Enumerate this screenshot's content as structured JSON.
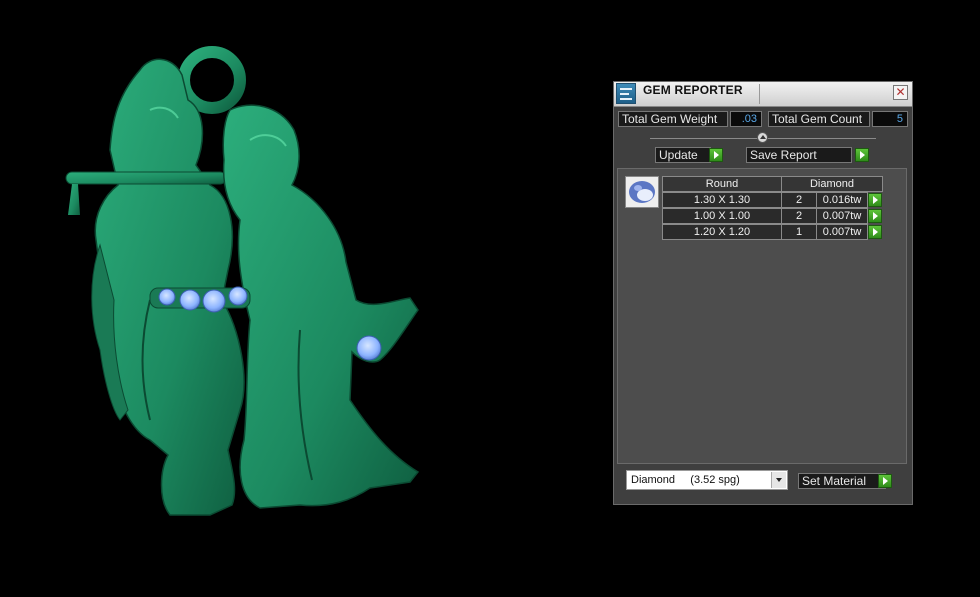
{
  "panel": {
    "title": "GEM REPORTER",
    "close_symbol": "✕",
    "total_weight_label": "Total Gem Weight",
    "total_weight_value": ".03",
    "total_count_label": "Total Gem Count",
    "total_count_value": "5",
    "update_label": "Update",
    "save_report_label": "Save Report",
    "table": {
      "headers": [
        "Round",
        "Diamond"
      ],
      "rows": [
        {
          "size": "1.30 X 1.30",
          "count": "2",
          "weight": "0.016tw"
        },
        {
          "size": "1.00 X 1.00",
          "count": "2",
          "weight": "0.007tw"
        },
        {
          "size": "1.20 X 1.20",
          "count": "1",
          "weight": "0.007tw"
        }
      ]
    },
    "material_select": "Diamond     (3.52 spg)",
    "set_material_label": "Set Material"
  },
  "icons": {
    "app": "gem-reporter-app-icon",
    "close": "close-icon",
    "gem_shape": "round-gem-icon",
    "go": "green-arrow-icon",
    "dropdown": "chevron-down-icon"
  },
  "colors": {
    "model_green": "#1f8a62",
    "gem_blue": "#8fb6ff",
    "go_green": "#3fa82a",
    "value_blue": "#5aa8e8"
  }
}
